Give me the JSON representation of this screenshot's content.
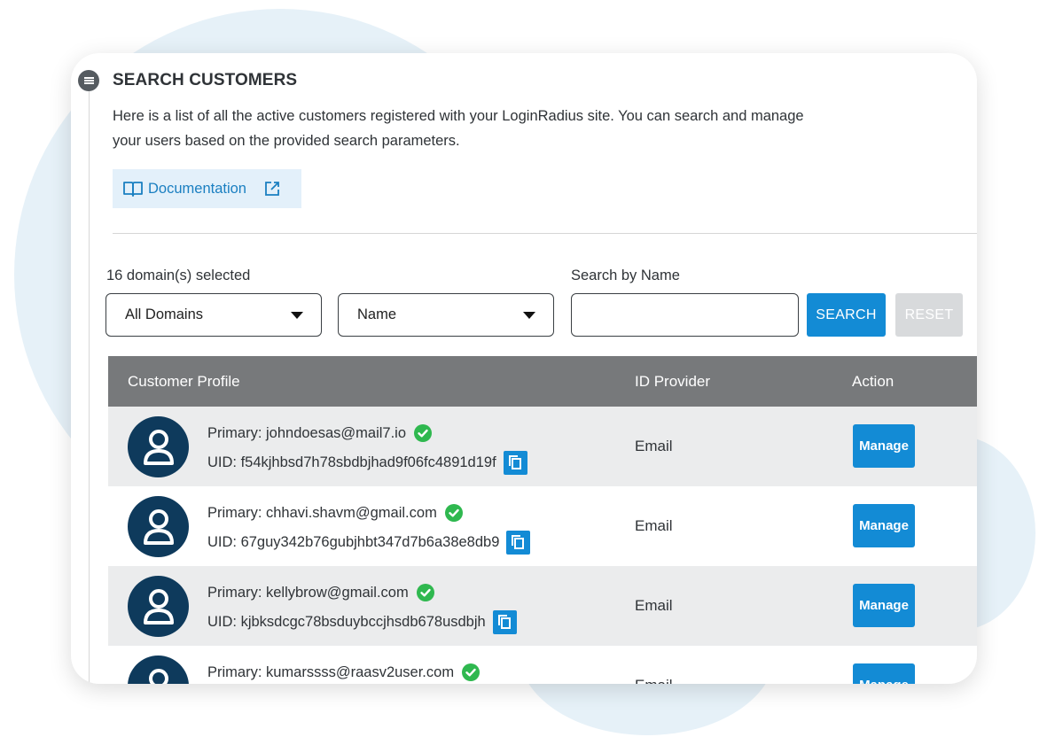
{
  "header": {
    "title": "SEARCH CUSTOMERS",
    "description": "Here is a list of all the active customers registered with your LoginRadius site. You can search and manage your users based on the provided search parameters.",
    "doc_link": "Documentation"
  },
  "filters": {
    "domains_selected": "16 domain(s) selected",
    "domain_select": "All Domains",
    "field_select": "Name",
    "search_label": "Search by Name",
    "search_value": "",
    "search_button": "SEARCH",
    "reset_button": "RESET"
  },
  "table": {
    "headers": [
      "Customer Profile",
      "ID Provider",
      "Action"
    ],
    "rows": [
      {
        "primary": "Primary: johndoesas@mail7.io",
        "uid": "UID: f54kjhbsd7h78sbdbjhad9f06fc4891d19f",
        "provider": "Email",
        "action": "Manage"
      },
      {
        "primary": "Primary: chhavi.shavm@gmail.com",
        "uid": "UID: 67guy342b76gubjhbt347d7b6a38e8db9",
        "provider": "Email",
        "action": "Manage"
      },
      {
        "primary": "Primary: kellybrow@gmail.com",
        "uid": "UID: kjbksdcgc78bsduybccjhsdb678usdbjh",
        "provider": "Email",
        "action": "Manage"
      },
      {
        "primary": "Primary: kumarssss@raasv2user.com",
        "uid": "",
        "provider": "Email",
        "action": "Manage"
      }
    ]
  },
  "colors": {
    "accent": "#138bd5",
    "avatar": "#0e3a5c",
    "verified": "#2fb84f",
    "table_header": "#77797b"
  }
}
